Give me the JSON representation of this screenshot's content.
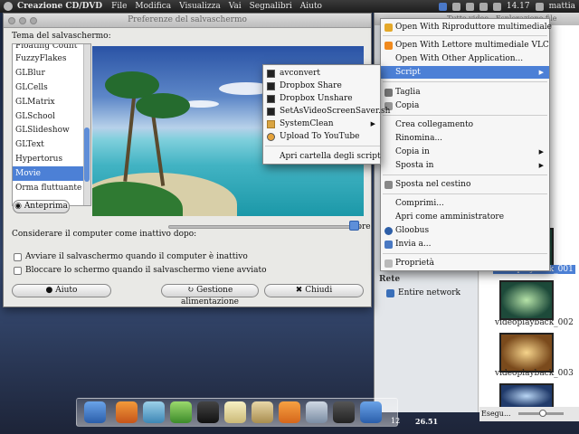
{
  "topbar": {
    "app_name": "Creazione CD/DVD",
    "menu": [
      "File",
      "Modifica",
      "Visualizza",
      "Vai",
      "Segnalibri",
      "Aiuto"
    ],
    "time": "14.17",
    "user": "mattia"
  },
  "prefs_window": {
    "title": "Preferenze del salvaschermo",
    "theme_label": "Tema del salvaschermo:",
    "themes": [
      "Floating Count",
      "FuzzyFlakes",
      "GLBlur",
      "GLCells",
      "GLMatrix",
      "GLSchool",
      "GLSlideshow",
      "GLText",
      "Hypertorus",
      "Movie",
      "Orma fluttuante"
    ],
    "selected_theme": "Movie",
    "preview_button": "Anteprima",
    "inactive_label": "Considerare il computer come inattivo dopo:",
    "slider_value": "2 ore",
    "slider_fraction": 0.95,
    "checkbox_activate": "Avviare il salvaschermo quando il computer è inattivo",
    "checkbox_lock": "Bloccare lo schermo quando il salvaschermo viene avviato",
    "help_button": "Aiuto",
    "power_button": "Gestione alimentazione",
    "close_button": "Chiudi"
  },
  "context_menu": {
    "items": [
      {
        "label": "Open With Riproduttore multimediale",
        "icon": "media-player-icon"
      },
      {
        "label": "Open With Lettore multimediale VLC",
        "icon": "vlc-icon"
      },
      {
        "label": "Open With Other Application...",
        "icon": ""
      },
      {
        "label": "Script",
        "icon": "",
        "submenu": true,
        "highlighted": true
      },
      {
        "label": "Taglia",
        "icon": "cut-icon"
      },
      {
        "label": "Copia",
        "icon": "copy-icon"
      },
      {
        "label": "Crea collegamento",
        "icon": ""
      },
      {
        "label": "Rinomina...",
        "icon": ""
      },
      {
        "label": "Copia in",
        "icon": "",
        "submenu": true
      },
      {
        "label": "Sposta in",
        "icon": "",
        "submenu": true
      },
      {
        "label": "Sposta nel cestino",
        "icon": "trash-icon"
      },
      {
        "label": "Comprimi...",
        "icon": ""
      },
      {
        "label": "Apri come amministratore",
        "icon": ""
      },
      {
        "label": "Gloobus",
        "icon": "gloobus-icon"
      },
      {
        "label": "Invia a...",
        "icon": "send-icon"
      },
      {
        "label": "Proprietà",
        "icon": "properties-icon"
      }
    ]
  },
  "script_submenu": {
    "items": [
      {
        "label": "avconvert",
        "icon": "terminal-icon"
      },
      {
        "label": "Dropbox Share",
        "icon": "terminal-icon"
      },
      {
        "label": "Dropbox Unshare",
        "icon": "terminal-icon"
      },
      {
        "label": "SetAsVideoScreenSaver.sh",
        "icon": "terminal-icon"
      },
      {
        "label": "SystemClean",
        "icon": "folder-icon",
        "submenu": true
      },
      {
        "label": "Upload To YouTube",
        "icon": "web-icon"
      }
    ],
    "open_folder": "Apri cartella degli script"
  },
  "file_manager": {
    "title": "Tutto video - Esplorazione file",
    "rete_label": "Rete",
    "network_item": "Entire network",
    "videos": [
      "videoplayback_001",
      "videoplayback_002",
      "videoplayback_003"
    ],
    "selected_video": "videoplayback_001",
    "status": "Esegu..."
  },
  "dock": {
    "clock": "26.51",
    "day": "12"
  }
}
